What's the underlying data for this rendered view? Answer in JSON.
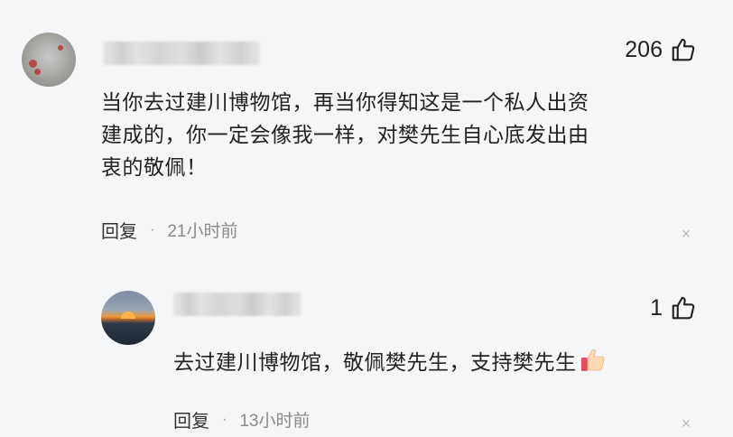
{
  "main_comment": {
    "likes": "206",
    "text_lines": [
      "当你去过建川博物馆，再当你得知这是一个私人出资",
      "建成的，你一定会像我一样，对樊先生自心底发出由",
      "衷的敬佩！"
    ],
    "reply_label": "回复",
    "separator": "·",
    "time": "21小时前",
    "close_glyph": "×"
  },
  "reply_comment": {
    "likes": "1",
    "text": "去过建川博物馆，敬佩樊先生，支持樊先生",
    "reply_label": "回复",
    "separator": "·",
    "time": "13小时前",
    "close_glyph": "×"
  },
  "icons": {
    "like": "thumb-up-outline-icon",
    "emoji": "thumbs-up-emoji-icon",
    "close": "close-icon"
  },
  "colors": {
    "background": "#f5f6f8",
    "text": "#222222",
    "meta": "#8a8a8a"
  }
}
